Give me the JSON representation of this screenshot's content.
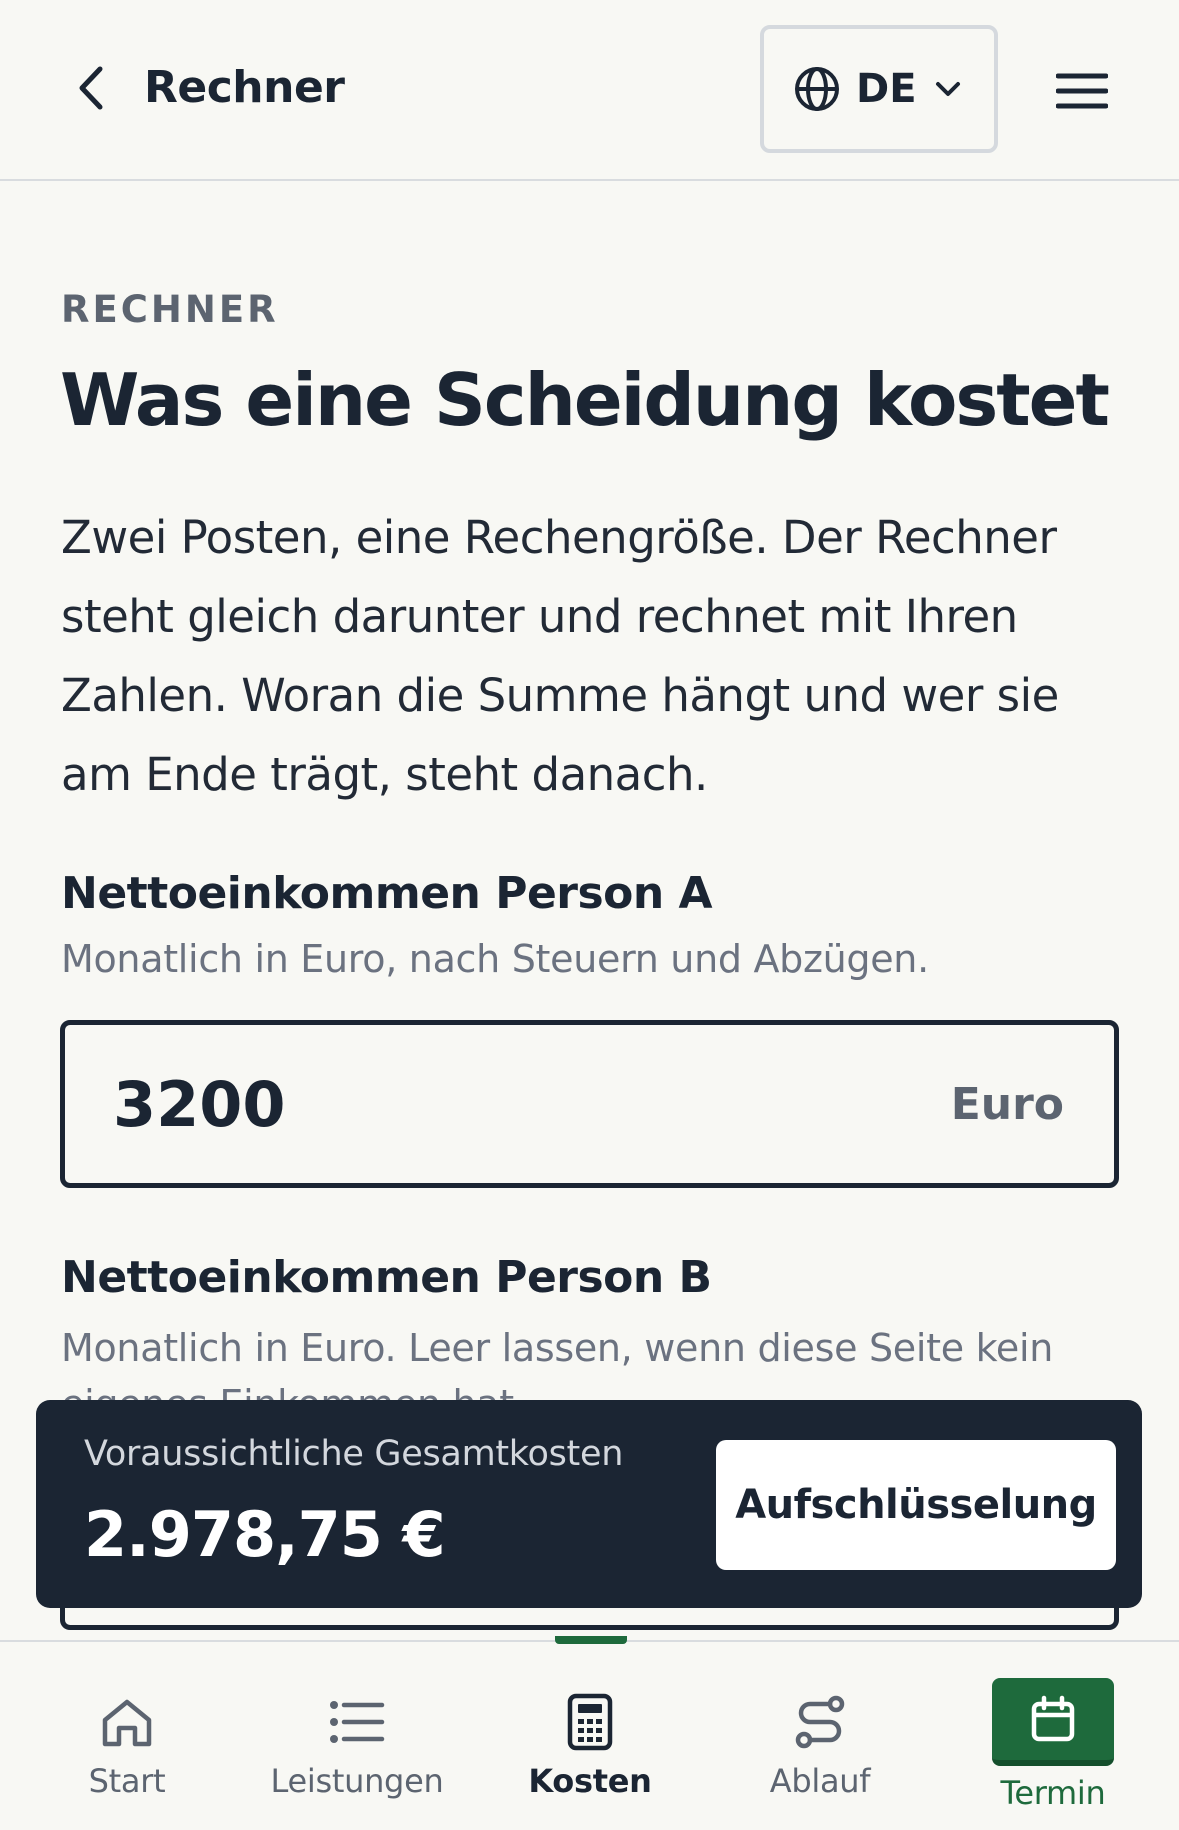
{
  "header": {
    "title": "Rechner",
    "language": "DE"
  },
  "intro": {
    "eyebrow": "RECHNER",
    "headline": "Was eine Scheidung kostet",
    "lead": "Zwei Posten, eine Rechengröße. Der Rechner steht gleich darunter und rechnet mit Ihren Zahlen. Woran die Summe hängt und wer sie am Ende trägt, steht danach."
  },
  "form": {
    "person_a": {
      "label": "Nettoeinkommen Person A",
      "hint": "Monatlich in Euro, nach Steuern und Abzügen.",
      "value": "3200",
      "unit": "Euro"
    },
    "person_b": {
      "label": "Nettoeinkommen Person B",
      "hint": "Monatlich in Euro. Leer lassen, wenn diese Seite kein eigenes Einkommen hat."
    }
  },
  "summary": {
    "label": "Voraussichtliche Gesamtkosten",
    "total": "2.978,75 €",
    "button": "Aufschlüsselung"
  },
  "tabs": [
    {
      "label": "Start",
      "icon": "home-icon"
    },
    {
      "label": "Leistungen",
      "icon": "list-icon"
    },
    {
      "label": "Kosten",
      "icon": "calculator-icon",
      "active": true
    },
    {
      "label": "Ablauf",
      "icon": "route-icon"
    },
    {
      "label": "Termin",
      "icon": "calendar-icon",
      "highlight": true
    }
  ],
  "colors": {
    "text": "#1b2533",
    "muted": "#6b7280",
    "background": "#f8f8f4",
    "summary_bg": "#1b2533",
    "accent_green": "#1e6a3c"
  }
}
